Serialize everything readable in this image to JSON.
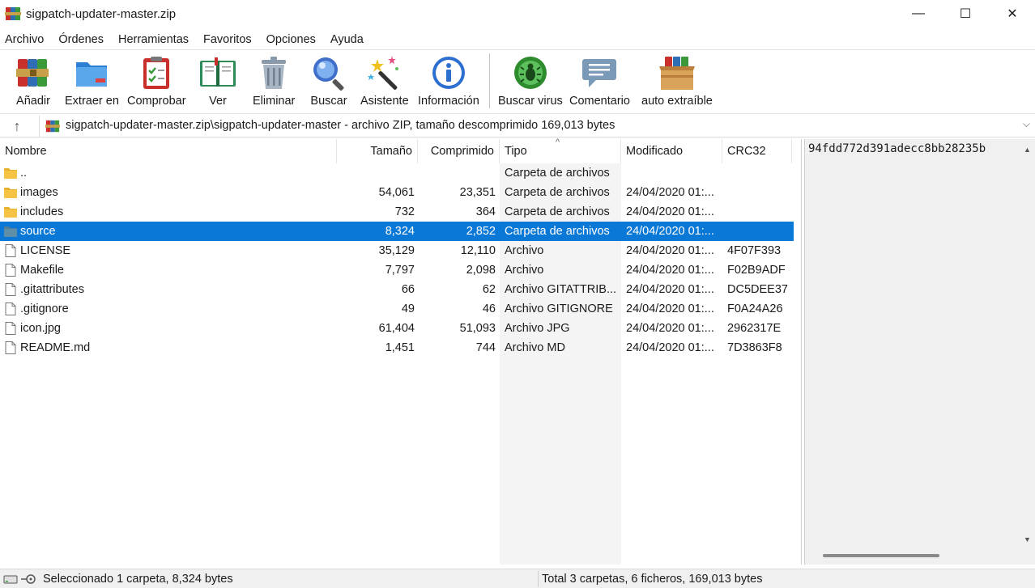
{
  "window": {
    "title": "sigpatch-updater-master.zip",
    "minimize_glyph": "—",
    "maximize_glyph": "☐",
    "close_glyph": "✕"
  },
  "menu": [
    "Archivo",
    "Órdenes",
    "Herramientas",
    "Favoritos",
    "Opciones",
    "Ayuda"
  ],
  "toolbar": [
    {
      "label": "Añadir",
      "icon": "add-archive-icon"
    },
    {
      "label": "Extraer en",
      "icon": "extract-folder-icon"
    },
    {
      "label": "Comprobar",
      "icon": "test-clipboard-icon"
    },
    {
      "label": "Ver",
      "icon": "book-view-icon"
    },
    {
      "label": "Eliminar",
      "icon": "trash-can-icon"
    },
    {
      "label": "Buscar",
      "icon": "magnifier-icon"
    },
    {
      "label": "Asistente",
      "icon": "wizard-wand-icon"
    },
    {
      "label": "Información",
      "icon": "info-icon"
    },
    {
      "label": "Buscar virus",
      "icon": "virus-scan-icon"
    },
    {
      "label": "Comentario",
      "icon": "comment-icon"
    },
    {
      "label": "auto extraíble",
      "icon": "sfx-box-icon"
    }
  ],
  "address": {
    "up_glyph": "↑",
    "path": "sigpatch-updater-master.zip\\sigpatch-updater-master - archivo ZIP, tamaño descomprimido 169,013 bytes",
    "dropdown_glyph": "⌵"
  },
  "columns": {
    "name": "Nombre",
    "size": "Tamaño",
    "compressed": "Comprimido",
    "type": "Tipo",
    "modified": "Modificado",
    "crc": "CRC32",
    "sort_glyph": "^"
  },
  "files": [
    {
      "name": "..",
      "size": "",
      "compressed": "",
      "type": "Carpeta de archivos",
      "modified": "",
      "crc": "",
      "kind": "folder",
      "selected": false
    },
    {
      "name": "images",
      "size": "54,061",
      "compressed": "23,351",
      "type": "Carpeta de archivos",
      "modified": "24/04/2020 01:...",
      "crc": "",
      "kind": "folder",
      "selected": false
    },
    {
      "name": "includes",
      "size": "732",
      "compressed": "364",
      "type": "Carpeta de archivos",
      "modified": "24/04/2020 01:...",
      "crc": "",
      "kind": "folder",
      "selected": false
    },
    {
      "name": "source",
      "size": "8,324",
      "compressed": "2,852",
      "type": "Carpeta de archivos",
      "modified": "24/04/2020 01:...",
      "crc": "",
      "kind": "folder",
      "selected": true
    },
    {
      "name": "LICENSE",
      "size": "35,129",
      "compressed": "12,110",
      "type": "Archivo",
      "modified": "24/04/2020 01:...",
      "crc": "4F07F393",
      "kind": "file",
      "selected": false
    },
    {
      "name": "Makefile",
      "size": "7,797",
      "compressed": "2,098",
      "type": "Archivo",
      "modified": "24/04/2020 01:...",
      "crc": "F02B9ADF",
      "kind": "file",
      "selected": false
    },
    {
      "name": ".gitattributes",
      "size": "66",
      "compressed": "62",
      "type": "Archivo GITATTRIB...",
      "modified": "24/04/2020 01:...",
      "crc": "DC5DEE37",
      "kind": "file",
      "selected": false
    },
    {
      "name": ".gitignore",
      "size": "49",
      "compressed": "46",
      "type": "Archivo GITIGNORE",
      "modified": "24/04/2020 01:...",
      "crc": "F0A24A26",
      "kind": "file",
      "selected": false
    },
    {
      "name": "icon.jpg",
      "size": "61,404",
      "compressed": "51,093",
      "type": "Archivo JPG",
      "modified": "24/04/2020 01:...",
      "crc": "2962317E",
      "kind": "file",
      "selected": false
    },
    {
      "name": "README.md",
      "size": "1,451",
      "compressed": "744",
      "type": "Archivo MD",
      "modified": "24/04/2020 01:...",
      "crc": "7D3863F8",
      "kind": "file",
      "selected": false
    }
  ],
  "comment": {
    "text": "94fdd772d391adecc8bb28235b"
  },
  "status": {
    "left": "Seleccionado 1 carpeta, 8,324 bytes",
    "right": "Total 3 carpetas, 6 ficheros, 169,013 bytes"
  },
  "colors": {
    "selection": "#0a78d7",
    "folder": "#f6c445",
    "folder_selected": "#5f8fa8"
  }
}
